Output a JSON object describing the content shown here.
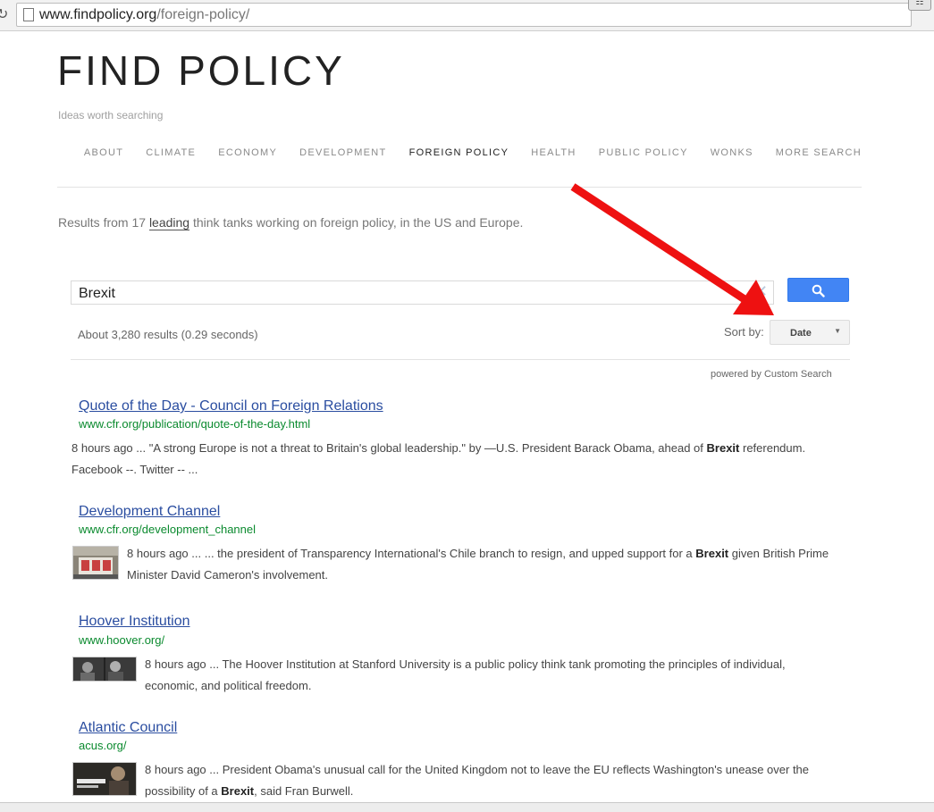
{
  "browser": {
    "url_host": "www.findpolicy.org",
    "url_path": "/foreign-policy/"
  },
  "site": {
    "title": "FIND POLICY",
    "tagline": "Ideas worth searching",
    "nav": [
      "ABOUT",
      "CLIMATE",
      "ECONOMY",
      "DEVELOPMENT",
      "FOREIGN POLICY",
      "HEALTH",
      "PUBLIC POLICY",
      "WONKS",
      "MORE SEARCH"
    ],
    "active_nav": "FOREIGN POLICY",
    "intro_before": "Results from 17 ",
    "intro_link": "leading",
    "intro_after": " think tanks working on foreign policy, in the US and Europe."
  },
  "search": {
    "query": "Brexit",
    "results_count": "About 3,280 results (0.29 seconds)",
    "sort_label": "Sort by:",
    "sort_value": "Date",
    "powered_by": "powered by",
    "powered_name": "Custom Search"
  },
  "results": [
    {
      "title": "Quote of the Day - Council on Foreign Relations",
      "url": "www.cfr.org/publication/quote-of-the-day.html",
      "time": "8 hours ago",
      "snippet_a": " ... \"A strong Europe is not a threat to Britain's global leadership.\" by —U.S. President Barack Obama, ahead of ",
      "snippet_b": "Brexit",
      "snippet_c": " referendum. Facebook --. Twitter -- ..."
    },
    {
      "title": "Development Channel",
      "url": "www.cfr.org/development_channel",
      "time": "8 hours ago",
      "snippet_a": " ... ... the president of Transparency International's Chile branch to resign, and upped support for a ",
      "snippet_b": "Brexit",
      "snippet_c": " given British Prime Minister David Cameron's involvement."
    },
    {
      "title": "Hoover Institution",
      "url": "www.hoover.org/",
      "time": "8 hours ago",
      "snippet_a": " ... The Hoover Institution at Stanford University is a public policy think tank promoting the principles of individual, economic, and political freedom.",
      "snippet_b": "",
      "snippet_c": ""
    },
    {
      "title": "Atlantic Council",
      "url": "acus.org/",
      "time": "8 hours ago",
      "snippet_a": " ... President Obama's unusual call for the United Kingdom not to leave the EU reflects Washington's unease over the possibility of a ",
      "snippet_b": "Brexit",
      "snippet_c": ", said Fran Burwell."
    }
  ],
  "colors": {
    "link": "#2a4da0",
    "url_green": "#0a8a2e",
    "search_blue": "#4285f4",
    "arrow_red": "#ee1111"
  }
}
